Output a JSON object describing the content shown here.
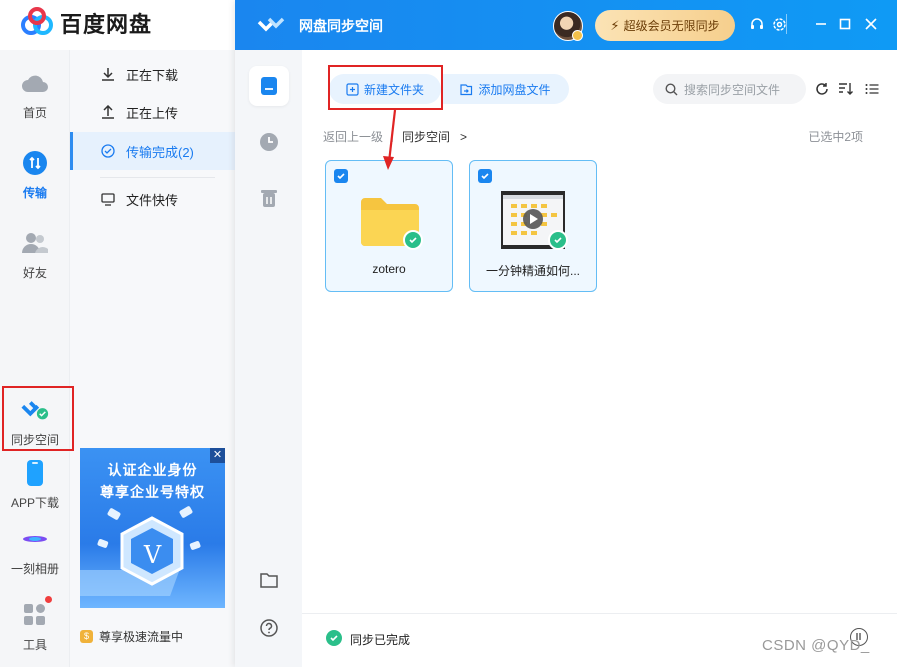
{
  "app": {
    "name": "百度网盘"
  },
  "left_rail": {
    "items": [
      {
        "label": "首页",
        "icon": "cloud-icon"
      },
      {
        "label": "传输",
        "icon": "transfer-icon",
        "active": true
      },
      {
        "label": "好友",
        "icon": "friends-icon"
      },
      {
        "label": "同步空间",
        "icon": "sync-space-icon"
      },
      {
        "label": "APP下载",
        "icon": "phone-icon"
      },
      {
        "label": "一刻相册",
        "icon": "album-icon"
      },
      {
        "label": "工具",
        "icon": "tools-icon"
      }
    ]
  },
  "transfer_panel": {
    "items": [
      {
        "label": "正在下载",
        "icon": "download-icon"
      },
      {
        "label": "正在上传",
        "icon": "upload-icon"
      },
      {
        "label": "传输完成(2)",
        "icon": "check-circle-icon",
        "active": true
      },
      {
        "label": "文件快传",
        "icon": "monitor-icon"
      }
    ]
  },
  "ad": {
    "line1": "认证企业身份",
    "line2": "尊享企业号特权",
    "close": "✕",
    "badge_letter": "V"
  },
  "promo": {
    "coin": "$",
    "text": "尊享极速流量中"
  },
  "sync_window": {
    "title": "网盘同步空间",
    "vip_button": "超级会员无限同步",
    "toolbar": {
      "new_folder": "新建文件夹",
      "add_file": "添加网盘文件",
      "search_placeholder": "搜索同步空间文件"
    },
    "breadcrumb": {
      "back": "返回上一级",
      "current": "同步空间",
      "arrow": ">"
    },
    "selected_count": "已选中2项",
    "files": [
      {
        "name": "zotero",
        "type": "folder"
      },
      {
        "name": "一分钟精通如何...",
        "type": "video"
      }
    ],
    "status": "同步已完成"
  },
  "watermark": "CSDN @QYD_",
  "colors": {
    "accent": "#1a86ef",
    "success": "#2bbf8a",
    "annotation": "#e02424",
    "vip": "#f6cf8d"
  }
}
